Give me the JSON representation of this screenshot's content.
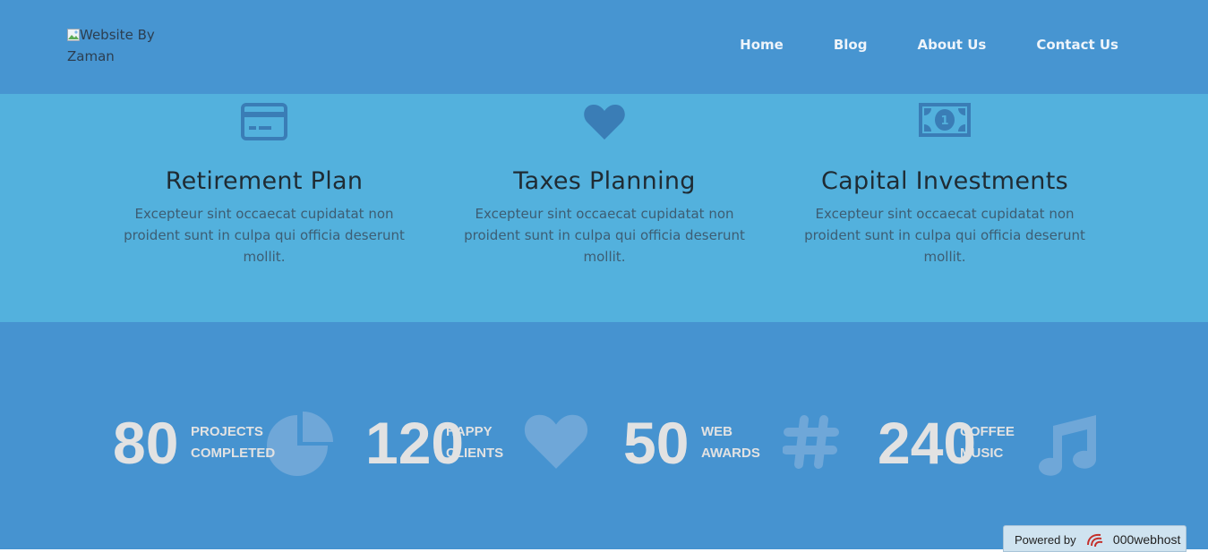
{
  "header": {
    "logo_alt": "Website By Zaman",
    "nav": [
      {
        "label": "Home"
      },
      {
        "label": "Blog"
      },
      {
        "label": "About Us"
      },
      {
        "label": "Contact Us"
      }
    ]
  },
  "services": [
    {
      "icon": "credit-card-icon",
      "title": "Retirement Plan",
      "text": "Excepteur sint occaecat cupidatat non proident sunt in culpa qui officia deserunt mollit."
    },
    {
      "icon": "heart-icon",
      "title": "Taxes Planning",
      "text": "Excepteur sint occaecat cupidatat non proident sunt in culpa qui officia deserunt mollit."
    },
    {
      "icon": "money-bill-icon",
      "title": "Capital Investments",
      "text": "Excepteur sint occaecat cupidatat non proident sunt in culpa qui officia deserunt mollit."
    }
  ],
  "stats": [
    {
      "value": "80",
      "label_line1": "PROJECTS",
      "label_line2": "COMPLETED",
      "icon": "pie-chart-icon"
    },
    {
      "value": "120",
      "label_line1": "HAPPY",
      "label_line2": "CLIENTS",
      "icon": "heart-icon"
    },
    {
      "value": "50",
      "label_line1": "WEB",
      "label_line2": "AWARDS",
      "icon": "hashtag-icon"
    },
    {
      "value": "240",
      "label_line1": "COFFEE",
      "label_line2": "MUSIC",
      "icon": "music-note-icon"
    }
  ],
  "powered": {
    "prefix": "Powered by",
    "brand": "000webhost"
  },
  "colors": {
    "header_bg": "#4795d1",
    "services_bg": "#53b1dd",
    "stats_bg": "#4693d0",
    "service_icon": "#3a7db6",
    "stat_icon": "#6fa7d8"
  }
}
